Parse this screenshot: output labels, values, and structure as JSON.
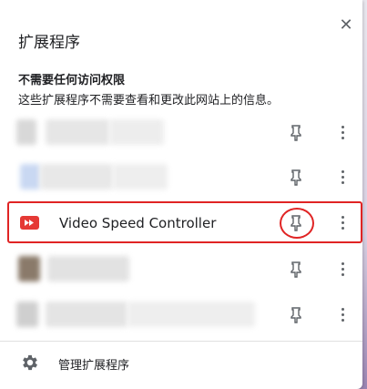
{
  "panel": {
    "title": "扩展程序",
    "close_icon": "close-icon"
  },
  "section": {
    "heading": "不需要任何访问权限",
    "description": "这些扩展程序不需要查看和更改此网站上的信息。"
  },
  "extensions": [
    {
      "name": "",
      "blurred": true
    },
    {
      "name": "",
      "blurred": true
    },
    {
      "name": "Video Speed Controller",
      "blurred": false,
      "highlighted": true
    },
    {
      "name": "",
      "blurred": true
    },
    {
      "name": "",
      "blurred": true
    }
  ],
  "footer": {
    "manage_label": "管理扩展程序",
    "icon": "gear-icon"
  },
  "colors": {
    "highlight": "#e02424",
    "extension_icon": "#e53935",
    "icon_gray": "#5f6368"
  }
}
